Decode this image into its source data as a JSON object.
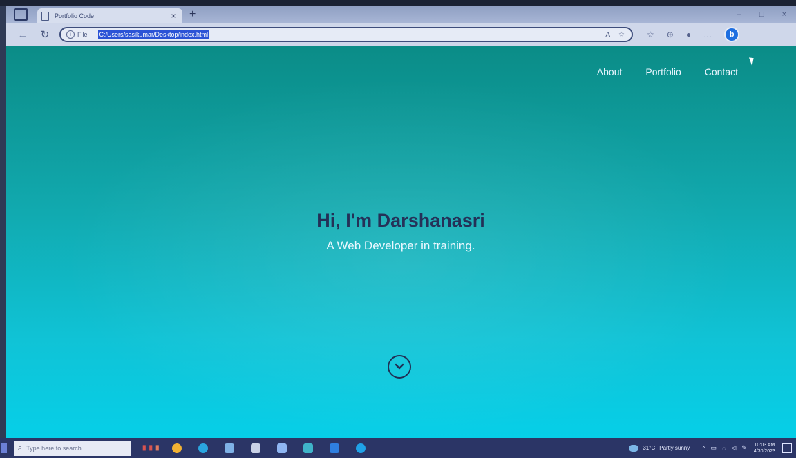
{
  "browser": {
    "tab_title": "Portfolio Code",
    "tab_close": "×",
    "new_tab": "+",
    "window_controls": [
      "–",
      "□",
      "×"
    ],
    "back": "←",
    "reload": "↻",
    "info_glyph": "i",
    "file_label": "File",
    "url": "C:/Users/sasikumar/Desktop/index.html",
    "omnibox_icons": [
      "A",
      "☆"
    ],
    "toolbar_icons": [
      "☆",
      "⊕",
      "●",
      "…"
    ],
    "bing": "b"
  },
  "page": {
    "nav": [
      "About",
      "Portfolio",
      "Contact"
    ],
    "hero_title": "Hi, I'm Darshanasri",
    "hero_subtitle": "A Web Developer in training.",
    "colors": {
      "gradient_top": "#0b8c87",
      "gradient_bottom": "#06cfe8",
      "title": "#13204a",
      "subtitle": "#e8f7ff"
    }
  },
  "taskbar": {
    "search_placeholder": "Type here to search",
    "search_glass": "⌕",
    "weather_temp": "31°C",
    "weather_desc": "Partly sunny",
    "tray_arrow": "^",
    "time": "10:03 AM",
    "date": "4/30/2023"
  }
}
